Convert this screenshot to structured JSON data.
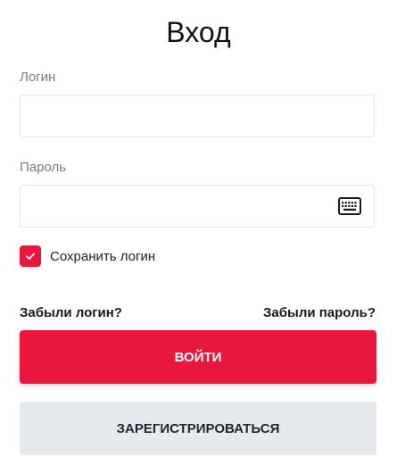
{
  "title": "Вход",
  "login": {
    "label": "Логин",
    "value": "",
    "placeholder": ""
  },
  "password": {
    "label": "Пароль",
    "value": "",
    "placeholder": "",
    "icon": "keyboard-icon"
  },
  "remember": {
    "label": "Сохранить логин",
    "checked": true,
    "icon": "checkmark-icon"
  },
  "links": {
    "forgot_login": "Забыли логин?",
    "forgot_password": "Забыли пароль?"
  },
  "buttons": {
    "login": "ВОЙТИ",
    "register": "ЗАРЕГИСТРИРОВАТЬСЯ"
  },
  "colors": {
    "accent": "#e8173b",
    "secondary_button": "#e6e9ed"
  }
}
